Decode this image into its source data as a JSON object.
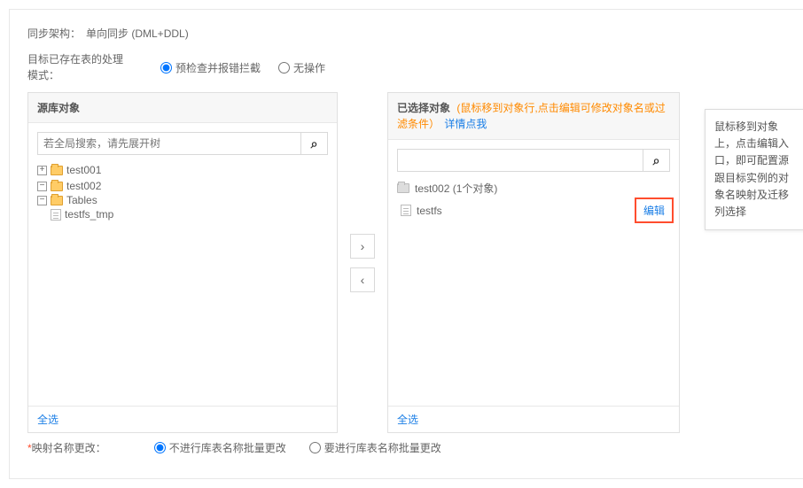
{
  "sync_arch": {
    "label": "同步架构：",
    "value": "单向同步 (DML+DDL)"
  },
  "table_mode": {
    "label": "目标已存在表的处理模式：",
    "opts": [
      "预检查并报错拦截",
      "无操作"
    ]
  },
  "left": {
    "title": "源库对象",
    "search_ph": "若全局搜索，请先展开树",
    "tree": {
      "db1": "test001",
      "db2": "test002",
      "tables_label": "Tables",
      "table1": "testfs_tmp"
    },
    "footer": "全选"
  },
  "right": {
    "title": "已选择对象",
    "hint": "(鼠标移到对象行,点击编辑可修改对象名或过滤条件）",
    "hint_link": "详情点我",
    "item_db": "test002 (1个对象)",
    "item_table": "testfs",
    "edit": "编辑",
    "footer": "全选"
  },
  "tooltip": "鼠标移到对象上，点击编辑入口，即可配置源跟目标实例的对象名映射及迁移列选择",
  "mapping": {
    "label": "映射名称更改：",
    "opts": [
      "不进行库表名称批量更改",
      "要进行库表名称批量更改"
    ]
  }
}
